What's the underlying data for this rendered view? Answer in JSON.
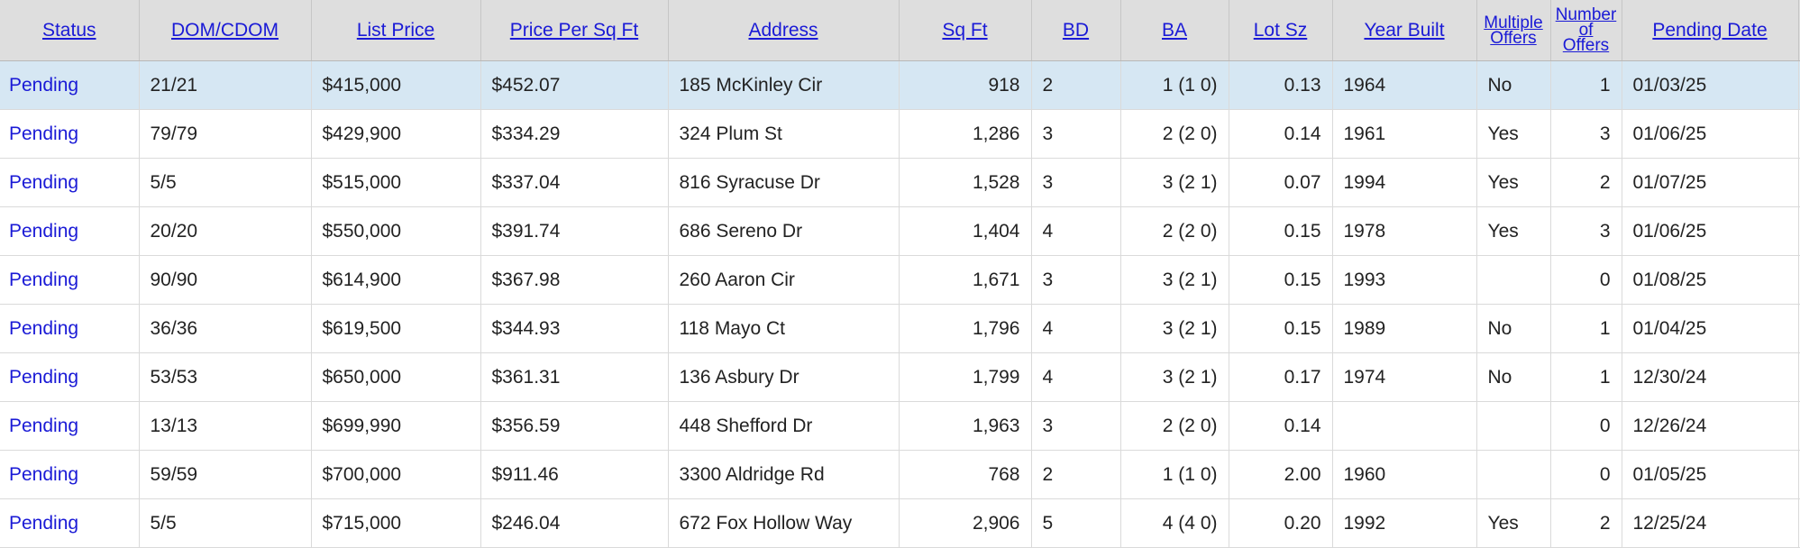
{
  "headers": {
    "status": "Status",
    "dom_cdom": "DOM/CDOM",
    "list_price": "List Price",
    "price_per_sqft": "Price Per Sq Ft",
    "address": "Address",
    "sqft": "Sq Ft",
    "bd": "BD",
    "ba": "BA",
    "lot_sz": "Lot Sz",
    "year_built": "Year Built",
    "multiple_offers_line1": "Multiple",
    "multiple_offers_line2": "Offers",
    "number_of_offers_line1": "Number",
    "number_of_offers_line2": "of",
    "number_of_offers_line3": "Offers",
    "pending_date": "Pending Date"
  },
  "rows": [
    {
      "status": "Pending",
      "dom_cdom": "21/21",
      "list_price": "$415,000",
      "price_per_sqft": "$452.07",
      "address": "185 McKinley Cir",
      "sqft": "918",
      "bd": "2",
      "ba": "1 (1 0)",
      "lot_sz": "0.13",
      "year_built": "1964",
      "multiple_offers": "No",
      "number_of_offers": "1",
      "pending_date": "01/03/25"
    },
    {
      "status": "Pending",
      "dom_cdom": "79/79",
      "list_price": "$429,900",
      "price_per_sqft": "$334.29",
      "address": "324 Plum St",
      "sqft": "1,286",
      "bd": "3",
      "ba": "2 (2 0)",
      "lot_sz": "0.14",
      "year_built": "1961",
      "multiple_offers": "Yes",
      "number_of_offers": "3",
      "pending_date": "01/06/25"
    },
    {
      "status": "Pending",
      "dom_cdom": "5/5",
      "list_price": "$515,000",
      "price_per_sqft": "$337.04",
      "address": "816 Syracuse Dr",
      "sqft": "1,528",
      "bd": "3",
      "ba": "3 (2 1)",
      "lot_sz": "0.07",
      "year_built": "1994",
      "multiple_offers": "Yes",
      "number_of_offers": "2",
      "pending_date": "01/07/25"
    },
    {
      "status": "Pending",
      "dom_cdom": "20/20",
      "list_price": "$550,000",
      "price_per_sqft": "$391.74",
      "address": "686 Sereno Dr",
      "sqft": "1,404",
      "bd": "4",
      "ba": "2 (2 0)",
      "lot_sz": "0.15",
      "year_built": "1978",
      "multiple_offers": "Yes",
      "number_of_offers": "3",
      "pending_date": "01/06/25"
    },
    {
      "status": "Pending",
      "dom_cdom": "90/90",
      "list_price": "$614,900",
      "price_per_sqft": "$367.98",
      "address": "260 Aaron Cir",
      "sqft": "1,671",
      "bd": "3",
      "ba": "3 (2 1)",
      "lot_sz": "0.15",
      "year_built": "1993",
      "multiple_offers": "",
      "number_of_offers": "0",
      "pending_date": "01/08/25"
    },
    {
      "status": "Pending",
      "dom_cdom": "36/36",
      "list_price": "$619,500",
      "price_per_sqft": "$344.93",
      "address": "118 Mayo Ct",
      "sqft": "1,796",
      "bd": "4",
      "ba": "3 (2 1)",
      "lot_sz": "0.15",
      "year_built": "1989",
      "multiple_offers": "No",
      "number_of_offers": "1",
      "pending_date": "01/04/25"
    },
    {
      "status": "Pending",
      "dom_cdom": "53/53",
      "list_price": "$650,000",
      "price_per_sqft": "$361.31",
      "address": "136 Asbury Dr",
      "sqft": "1,799",
      "bd": "4",
      "ba": "3 (2 1)",
      "lot_sz": "0.17",
      "year_built": "1974",
      "multiple_offers": "No",
      "number_of_offers": "1",
      "pending_date": "12/30/24"
    },
    {
      "status": "Pending",
      "dom_cdom": "13/13",
      "list_price": "$699,990",
      "price_per_sqft": "$356.59",
      "address": "448 Shefford Dr",
      "sqft": "1,963",
      "bd": "3",
      "ba": "2 (2 0)",
      "lot_sz": "0.14",
      "year_built": "",
      "multiple_offers": "",
      "number_of_offers": "0",
      "pending_date": "12/26/24"
    },
    {
      "status": "Pending",
      "dom_cdom": "59/59",
      "list_price": "$700,000",
      "price_per_sqft": "$911.46",
      "address": "3300 Aldridge Rd",
      "sqft": "768",
      "bd": "2",
      "ba": "1 (1 0)",
      "lot_sz": "2.00",
      "year_built": "1960",
      "multiple_offers": "",
      "number_of_offers": "0",
      "pending_date": "01/05/25"
    },
    {
      "status": "Pending",
      "dom_cdom": "5/5",
      "list_price": "$715,000",
      "price_per_sqft": "$246.04",
      "address": "672 Fox Hollow Way",
      "sqft": "2,906",
      "bd": "5",
      "ba": "4 (4 0)",
      "lot_sz": "0.20",
      "year_built": "1992",
      "multiple_offers": "Yes",
      "number_of_offers": "2",
      "pending_date": "12/25/24"
    }
  ],
  "selected_row": 0,
  "colors": {
    "link": "#1a1ad6",
    "header_bg": "#dedede",
    "selected_row_bg": "#d6e7f3"
  }
}
